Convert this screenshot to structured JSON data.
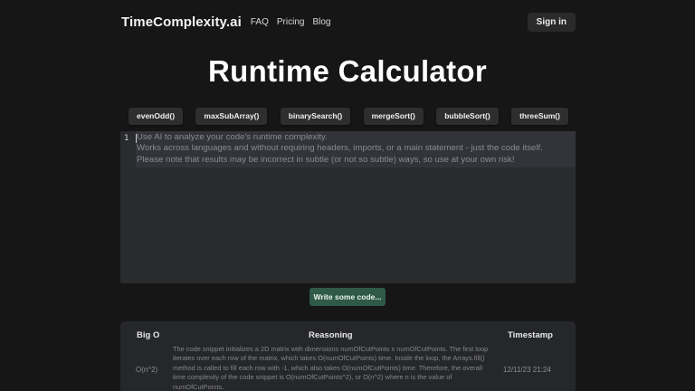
{
  "nav": {
    "brand": "TimeComplexity.ai",
    "links": [
      "FAQ",
      "Pricing",
      "Blog"
    ],
    "signin": "Sign in"
  },
  "page": {
    "title": "Runtime Calculator"
  },
  "examples": [
    "evenOdd()",
    "maxSubArray()",
    "binarySearch()",
    "mergeSort()",
    "bubbleSort()",
    "threeSum()"
  ],
  "editor": {
    "line_number": "1",
    "placeholder_lines": [
      "Use AI to analyze your code's runtime complexity.",
      "Works across languages and without requiring headers, imports, or a main statement - just the code itself.",
      "Please note that results may be incorrect in subtle (or not so subtle) ways, so use at your own risk!"
    ]
  },
  "submit": {
    "label": "Write some code..."
  },
  "results": {
    "headers": {
      "bigo": "Big O",
      "reasoning": "Reasoning",
      "timestamp": "Timestamp"
    },
    "rows": [
      {
        "bigo": "O(n^2)",
        "reasoning": "The code snippet initializes a 2D matrix with dimensions numOfCutPoints x numOfCutPoints. The first loop iterates over each row of the matrix, which takes O(numOfCutPoints) time. Inside the loop, the Arrays.fill() method is called to fill each row with -1, which also takes O(numOfCutPoints) time. Therefore, the overall time complexity of the code snippet is O(numOfCutPoints^2), or O(n^2) where n is the value of numOfCutPoints.",
        "timestamp": "12/11/23 21:24"
      }
    ]
  }
}
